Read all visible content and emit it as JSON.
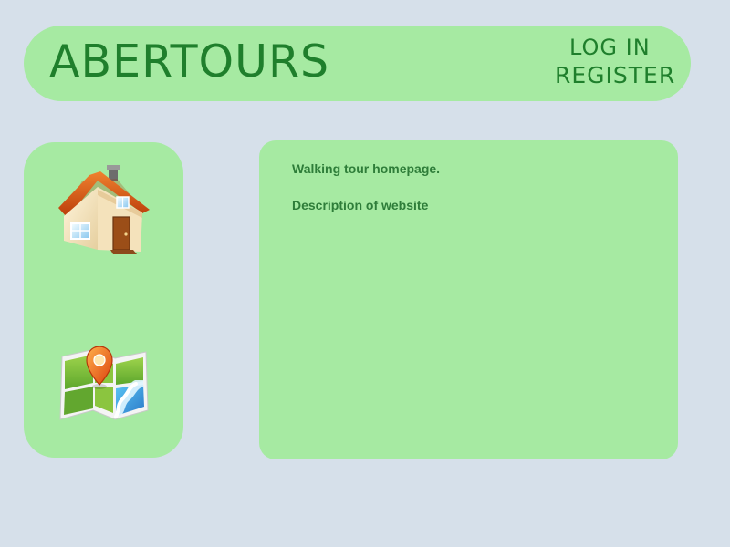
{
  "header": {
    "brand": "ABERTOURS",
    "login_label": "LOG IN",
    "register_label": "REGISTER"
  },
  "sidebar": {
    "items": [
      {
        "icon": "home-icon"
      },
      {
        "icon": "map-icon"
      }
    ]
  },
  "main": {
    "title": "Walking tour homepage.",
    "description": "Description of website"
  },
  "colors": {
    "background": "#d6e0ea",
    "panel": "#a6eaa2",
    "text": "#1f7f2c"
  }
}
